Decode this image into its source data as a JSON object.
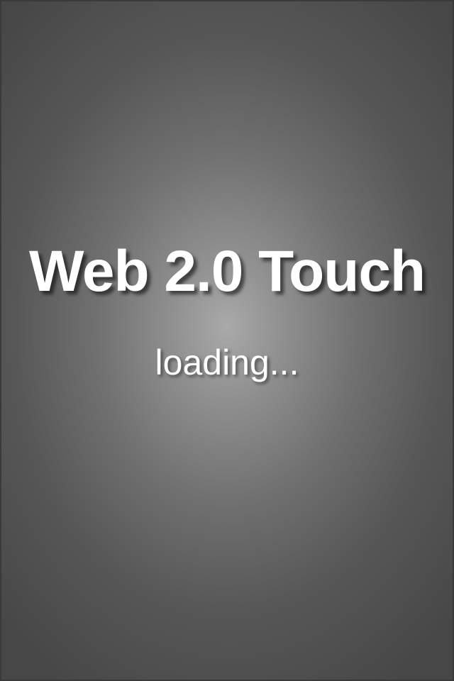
{
  "splash": {
    "title": "Web 2.0 Touch",
    "status": "loading..."
  },
  "colors": {
    "text": "#ffffff",
    "background_center": "#a9a9a9",
    "background_edge": "#474747"
  }
}
